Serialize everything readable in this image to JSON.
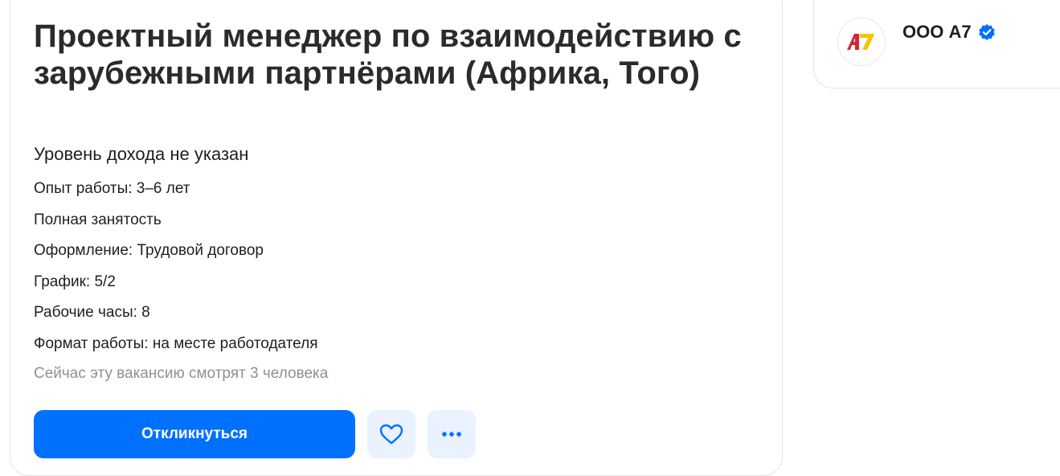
{
  "vacancy": {
    "title": "Проектный менеджер по взаимодействию с зарубежными партнёрами (Африка, Того)",
    "salary": "Уровень дохода не указан",
    "facts": [
      "Опыт работы: 3–6 лет",
      "Полная занятость",
      "Оформление: Трудовой договор",
      "График: 5/2",
      "Рабочие часы: 8",
      "Формат работы: на месте работодателя"
    ],
    "viewers": "Сейчас эту вакансию смотрят 3 человека",
    "actions": {
      "apply_label": "Откликнуться",
      "favorite_icon": "heart-icon",
      "more_icon": "more-dots-icon"
    }
  },
  "employer": {
    "name": "ООО А7",
    "logo_text": "A7",
    "verified_icon": "verified-badge-icon"
  },
  "colors": {
    "accent": "#0070ff",
    "icon_button_bg": "#eaf2ff",
    "muted_text": "#8b9199",
    "logo_red": "#d6243a",
    "logo_yellow": "#f5c400"
  }
}
